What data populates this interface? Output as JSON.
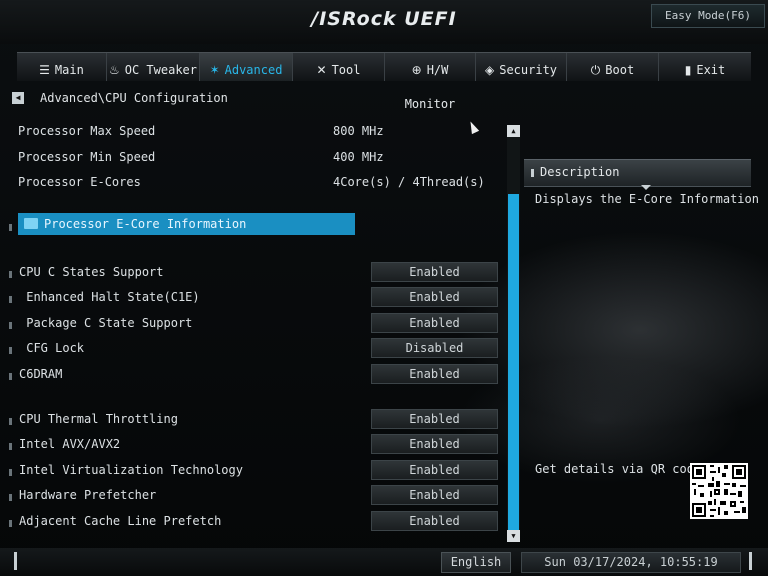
{
  "header": {
    "logo": "/ISRock UEFI",
    "easy_mode": "Easy Mode(F6)"
  },
  "tabs": [
    {
      "label": "Main",
      "icon": "list-icon",
      "glyph": "☰"
    },
    {
      "label": "OC Tweaker",
      "icon": "flame-icon",
      "glyph": "♨"
    },
    {
      "label": "Advanced",
      "icon": "star-icon",
      "glyph": "✶"
    },
    {
      "label": "Tool",
      "icon": "tools-icon",
      "glyph": "✕"
    },
    {
      "label": "H/W Monitor",
      "icon": "monitor-icon",
      "glyph": "⊕"
    },
    {
      "label": "Security",
      "icon": "shield-icon",
      "glyph": "◈"
    },
    {
      "label": "Boot",
      "icon": "power-icon",
      "glyph": "⏻"
    },
    {
      "label": "Exit",
      "icon": "exit-icon",
      "glyph": "▮"
    }
  ],
  "active_tab": "Advanced",
  "breadcrumb": "Advanced\\CPU Configuration",
  "info": [
    {
      "label": "Processor Max Speed",
      "value": "800 MHz"
    },
    {
      "label": "Processor Min Speed",
      "value": "400 MHz"
    },
    {
      "label": "Processor E-Cores",
      "value": "4Core(s) / 4Thread(s)"
    }
  ],
  "submenu": {
    "label": "Processor E-Core Information"
  },
  "settings": [
    {
      "label": "CPU C States Support",
      "value": "Enabled"
    },
    {
      "label": " Enhanced Halt State(C1E)",
      "value": "Enabled"
    },
    {
      "label": " Package C State Support",
      "value": "Enabled"
    },
    {
      "label": " CFG Lock",
      "value": "Disabled"
    },
    {
      "label": "C6DRAM",
      "value": "Enabled"
    },
    {
      "label": "CPU Thermal Throttling",
      "value": "Enabled"
    },
    {
      "label": "Intel AVX/AVX2",
      "value": "Enabled"
    },
    {
      "label": "Intel Virtualization Technology",
      "value": "Enabled"
    },
    {
      "label": "Hardware Prefetcher",
      "value": "Enabled"
    },
    {
      "label": "Adjacent Cache Line Prefetch",
      "value": "Enabled"
    }
  ],
  "description": {
    "title": "Description",
    "text": "Displays the E-Core Information",
    "qr_label": "Get details via QR code"
  },
  "footer": {
    "language": "English",
    "datetime": "Sun 03/17/2024, 10:55:19"
  },
  "colors": {
    "accent": "#1fa9e0",
    "selection": "#1a8fc2"
  }
}
